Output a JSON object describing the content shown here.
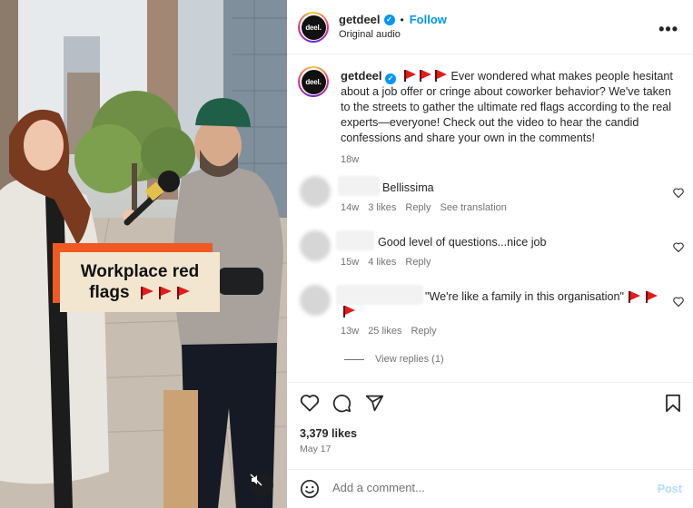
{
  "video": {
    "overlay_caption_line1": "Workplace red",
    "overlay_caption_line2": "flags",
    "mute_icon": "speaker-muted-icon"
  },
  "header": {
    "username": "getdeel",
    "avatar_text": "deel.",
    "separator": "•",
    "follow_label": "Follow",
    "audio": "Original audio",
    "more_icon": "more-horizontal-icon"
  },
  "post": {
    "username": "getdeel",
    "avatar_text": "deel.",
    "caption": "Ever wondered what makes people hesitant about a job offer or cringe about coworker behavior? We've taken to the streets to gather the ultimate red flags according to the real experts—everyone! Check out the video to hear the candid confessions and share your own in the comments!",
    "age": "18w"
  },
  "comments": [
    {
      "text": "Bellissima",
      "age": "14w",
      "likes": "3 likes",
      "reply": "Reply",
      "translate": "See translation"
    },
    {
      "text": "Good level of questions...nice job",
      "age": "15w",
      "likes": "4 likes",
      "reply": "Reply"
    },
    {
      "text": "\"We're like a family in this organisation\"",
      "age": "13w",
      "likes": "25 likes",
      "reply": "Reply",
      "view_replies": "View replies (1)"
    }
  ],
  "actions": {
    "likes": "3,379 likes",
    "date": "May 17",
    "comment_placeholder": "Add a comment...",
    "post_label": "Post"
  },
  "colors": {
    "accent_blue": "#0095f6",
    "flag_red": "#e21b1b",
    "caption_orange": "#f05a22",
    "caption_cream": "#f3e6d0"
  }
}
